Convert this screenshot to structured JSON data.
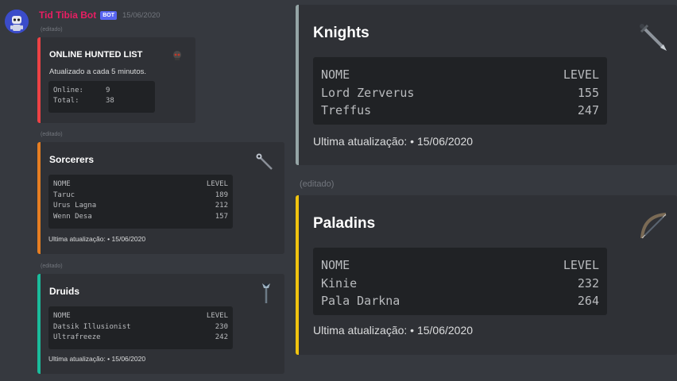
{
  "author": {
    "name": "Tid Tibia Bot",
    "badge": "BOT",
    "timestamp": "15/06/2020"
  },
  "edited_label": "(editado)",
  "online": {
    "title": "ONLINE HUNTED LIST",
    "description": "Atualizado a cada 5 minutos.",
    "accent": "#ed4245",
    "online_label": "Online:",
    "online_value": "9",
    "total_label": "Total:",
    "total_value": "38"
  },
  "sorcerers": {
    "title": "Sorcerers",
    "accent": "#e67e22",
    "col_name": "NOME",
    "col_level": "LEVEL",
    "rows": [
      {
        "name": "Taruc",
        "level": "189"
      },
      {
        "name": "Urus Lagna",
        "level": "212"
      },
      {
        "name": "Wenn Desa",
        "level": "157"
      }
    ],
    "footer": "Ultima atualização: • 15/06/2020"
  },
  "druids": {
    "title": "Druids",
    "accent": "#1abc9c",
    "col_name": "NOME",
    "col_level": "LEVEL",
    "rows": [
      {
        "name": "Datsik Illusionist",
        "level": "230"
      },
      {
        "name": "Ultrafreeze",
        "level": "242"
      }
    ],
    "footer": "Ultima atualização: • 15/06/2020"
  },
  "knights": {
    "title": "Knights",
    "accent": "#95a5a6",
    "col_name": "NOME",
    "col_level": "LEVEL",
    "rows": [
      {
        "name": "Lord Zerverus",
        "level": "155"
      },
      {
        "name": "Treffus",
        "level": "247"
      }
    ],
    "footer": "Ultima atualização: • 15/06/2020"
  },
  "paladins": {
    "title": "Paladins",
    "accent": "#f1c40f",
    "col_name": "NOME",
    "col_level": "LEVEL",
    "rows": [
      {
        "name": "Kinie",
        "level": "232"
      },
      {
        "name": "Pala Darkna",
        "level": "264"
      }
    ],
    "footer": "Ultima atualização: • 15/06/2020"
  }
}
